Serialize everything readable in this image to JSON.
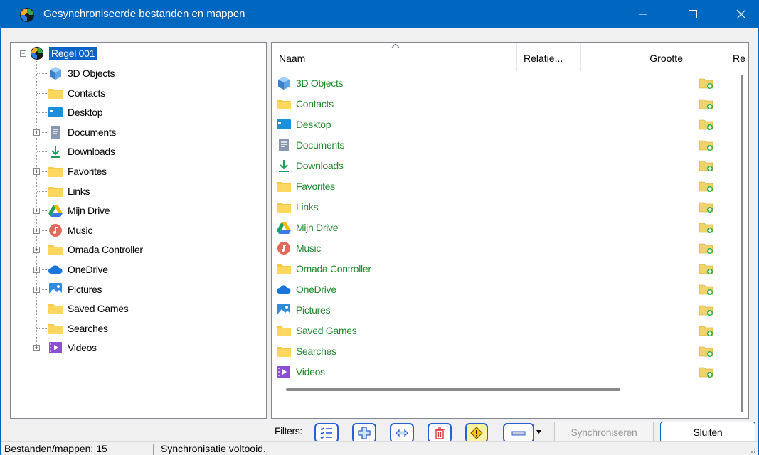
{
  "window": {
    "title": "Gesynchroniseerde bestanden en mappen",
    "accent": "#0067c0"
  },
  "tree": {
    "root": {
      "label": "Regel 001",
      "icon": "sync-app-icon"
    },
    "items": [
      {
        "label": "3D Objects",
        "icon": "3d-objects-icon",
        "expandable": false
      },
      {
        "label": "Contacts",
        "icon": "folder-icon",
        "expandable": false
      },
      {
        "label": "Desktop",
        "icon": "desktop-icon",
        "expandable": false
      },
      {
        "label": "Documents",
        "icon": "documents-icon",
        "expandable": true
      },
      {
        "label": "Downloads",
        "icon": "downloads-icon",
        "expandable": false
      },
      {
        "label": "Favorites",
        "icon": "folder-icon",
        "expandable": true
      },
      {
        "label": "Links",
        "icon": "folder-icon",
        "expandable": false
      },
      {
        "label": "Mijn Drive",
        "icon": "google-drive-icon",
        "expandable": true
      },
      {
        "label": "Music",
        "icon": "music-icon",
        "expandable": true
      },
      {
        "label": "Omada Controller",
        "icon": "folder-icon",
        "expandable": true
      },
      {
        "label": "OneDrive",
        "icon": "onedrive-icon",
        "expandable": true
      },
      {
        "label": "Pictures",
        "icon": "pictures-icon",
        "expandable": true
      },
      {
        "label": "Saved Games",
        "icon": "folder-icon",
        "expandable": false
      },
      {
        "label": "Searches",
        "icon": "folder-icon",
        "expandable": false
      },
      {
        "label": "Videos",
        "icon": "videos-icon",
        "expandable": true
      }
    ]
  },
  "list": {
    "columns": {
      "name": "Naam",
      "relation": "Relatie...",
      "size": "Grootte",
      "re": "Re"
    },
    "name_color": "#1f8a2e",
    "rows": [
      {
        "name": "3D Objects",
        "icon": "3d-objects-icon",
        "action_icon": "folder-add-icon"
      },
      {
        "name": "Contacts",
        "icon": "folder-icon",
        "action_icon": "folder-add-icon"
      },
      {
        "name": "Desktop",
        "icon": "desktop-icon",
        "action_icon": "folder-add-icon"
      },
      {
        "name": "Documents",
        "icon": "documents-icon",
        "action_icon": "folder-add-icon"
      },
      {
        "name": "Downloads",
        "icon": "downloads-icon",
        "action_icon": "folder-add-icon"
      },
      {
        "name": "Favorites",
        "icon": "folder-icon",
        "action_icon": "folder-add-icon"
      },
      {
        "name": "Links",
        "icon": "folder-icon",
        "action_icon": "folder-add-icon"
      },
      {
        "name": "Mijn Drive",
        "icon": "google-drive-icon",
        "action_icon": "folder-add-icon"
      },
      {
        "name": "Music",
        "icon": "music-icon",
        "action_icon": "folder-add-icon"
      },
      {
        "name": "Omada Controller",
        "icon": "folder-icon",
        "action_icon": "folder-add-icon"
      },
      {
        "name": "OneDrive",
        "icon": "onedrive-icon",
        "action_icon": "folder-add-icon"
      },
      {
        "name": "Pictures",
        "icon": "pictures-icon",
        "action_icon": "folder-add-icon"
      },
      {
        "name": "Saved Games",
        "icon": "folder-icon",
        "action_icon": "folder-add-icon"
      },
      {
        "name": "Searches",
        "icon": "folder-icon",
        "action_icon": "folder-add-icon"
      },
      {
        "name": "Videos",
        "icon": "videos-icon",
        "action_icon": "folder-add-icon"
      }
    ]
  },
  "filters": {
    "label": "Filters:",
    "buttons": [
      "list-filter-icon",
      "plus-icon",
      "swap-icon",
      "trash-icon",
      "warning-icon",
      "minus-icon"
    ]
  },
  "buttons": {
    "synchronize": "Synchroniseren",
    "close": "Sluiten"
  },
  "status": {
    "count": "Bestanden/mappen: 15",
    "message": "Synchronisatie voltooid."
  }
}
